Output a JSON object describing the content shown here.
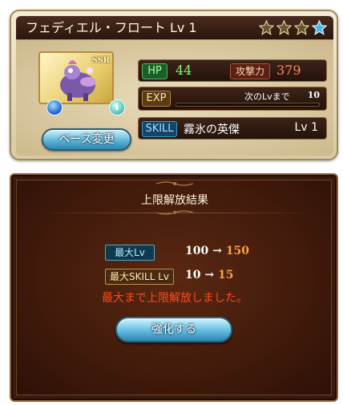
{
  "card": {
    "title": "フェディエル・フロート Lv 1",
    "rarity_badge": "SSR",
    "uncap_stars": {
      "filled": 3,
      "blue": 1
    },
    "stats": {
      "hp_label": "HP",
      "hp_value": "44",
      "attack_label": "攻撃力",
      "attack_value": "379"
    },
    "exp": {
      "label": "EXP",
      "next_label": "次のLvまで",
      "next_value": "10",
      "progress": 0.0
    },
    "skill": {
      "label": "SKILL",
      "name": "霧氷の英傑",
      "level": "Lv 1"
    },
    "base_change_button": "ベース変更",
    "element_icon": "water-element-icon",
    "info_icon": "info-icon",
    "info_glyph": "i"
  },
  "panel": {
    "title": "上限解放結果",
    "max_lv": {
      "label": "最大Lv",
      "old": "100",
      "arrow": "→",
      "new": "150"
    },
    "max_skill_lv": {
      "label": "最大SKILL Lv",
      "old": "10",
      "arrow": "→",
      "new": "15"
    },
    "note": "最大まで上限解放しました。",
    "strengthen_button": "強化する"
  },
  "colors": {
    "hp": "#8af57a",
    "attack": "#ff8a64",
    "new_value": "#ffa23c",
    "note": "#ff4a1c",
    "button": "#5fb6d8"
  }
}
